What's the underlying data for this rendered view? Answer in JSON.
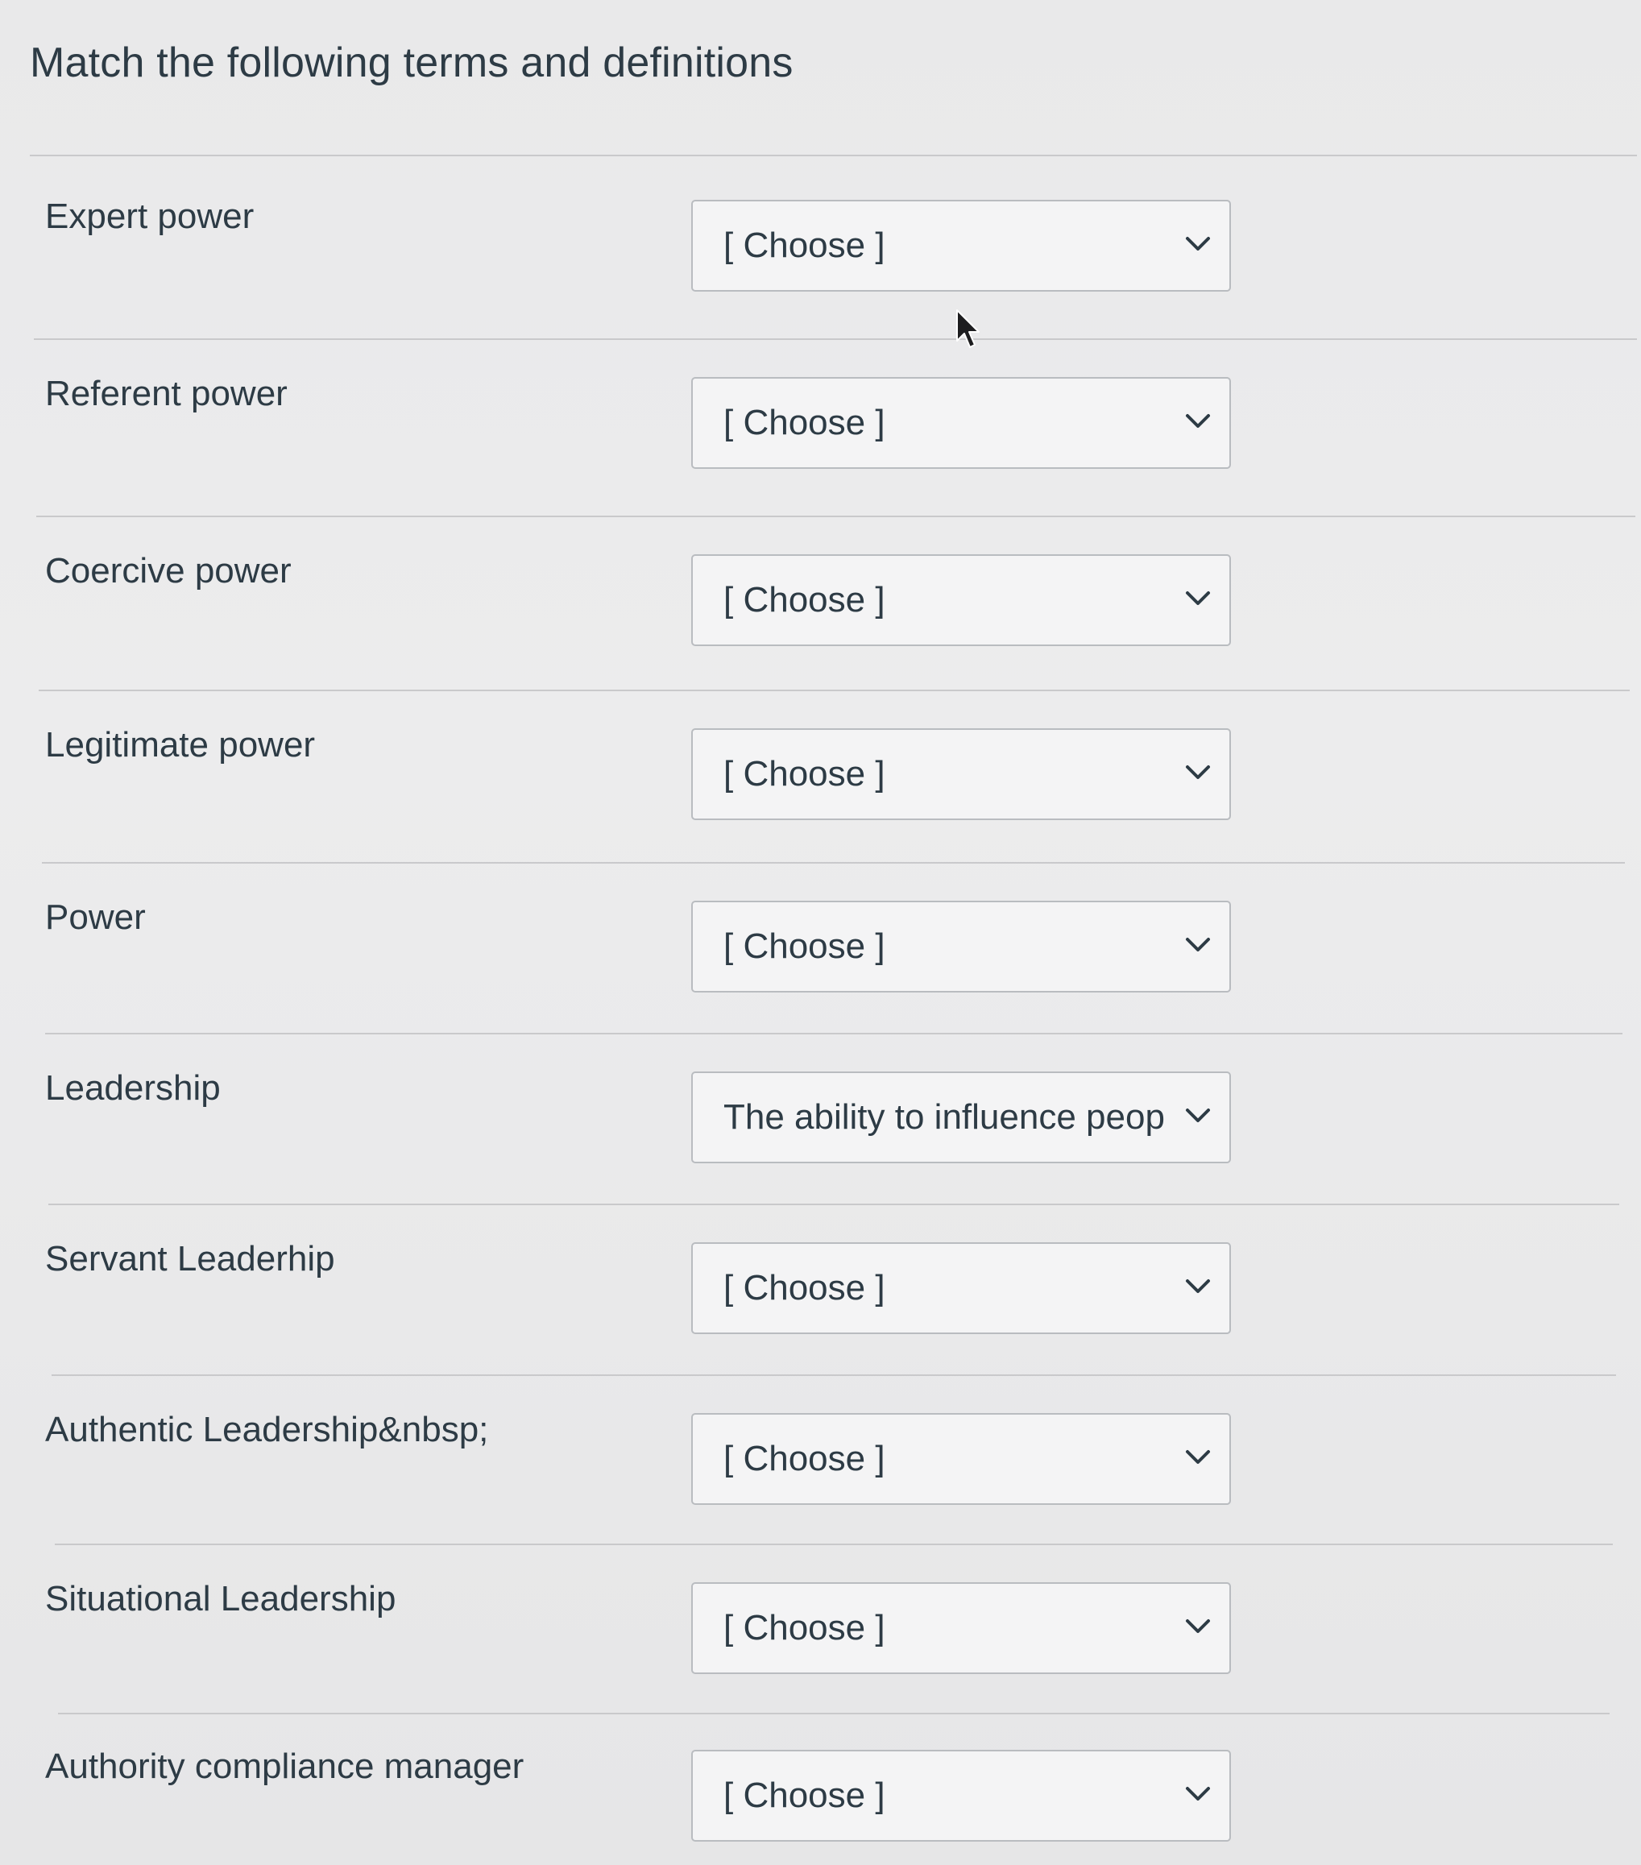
{
  "question": {
    "title": "Match the following terms and definitions"
  },
  "rows": [
    {
      "term": "Expert power",
      "selected": "[ Choose ]"
    },
    {
      "term": "Referent power",
      "selected": "[ Choose ]"
    },
    {
      "term": "Coercive power",
      "selected": "[ Choose ]"
    },
    {
      "term": "Legitimate power",
      "selected": "[ Choose ]"
    },
    {
      "term": "Power",
      "selected": "[ Choose ]"
    },
    {
      "term": "Leadership",
      "selected": "The ability to influence people"
    },
    {
      "term": "Servant Leaderhip",
      "selected": "[ Choose ]"
    },
    {
      "term": "Authentic Leadership&nbsp;",
      "selected": "[ Choose ]"
    },
    {
      "term": "Situational Leadership",
      "selected": "[ Choose ]"
    },
    {
      "term": "Authority compliance manager",
      "selected": "[ Choose ]"
    }
  ],
  "icons": {
    "dropdown": "chevron-down-icon",
    "pointer": "mouse-cursor-icon"
  }
}
